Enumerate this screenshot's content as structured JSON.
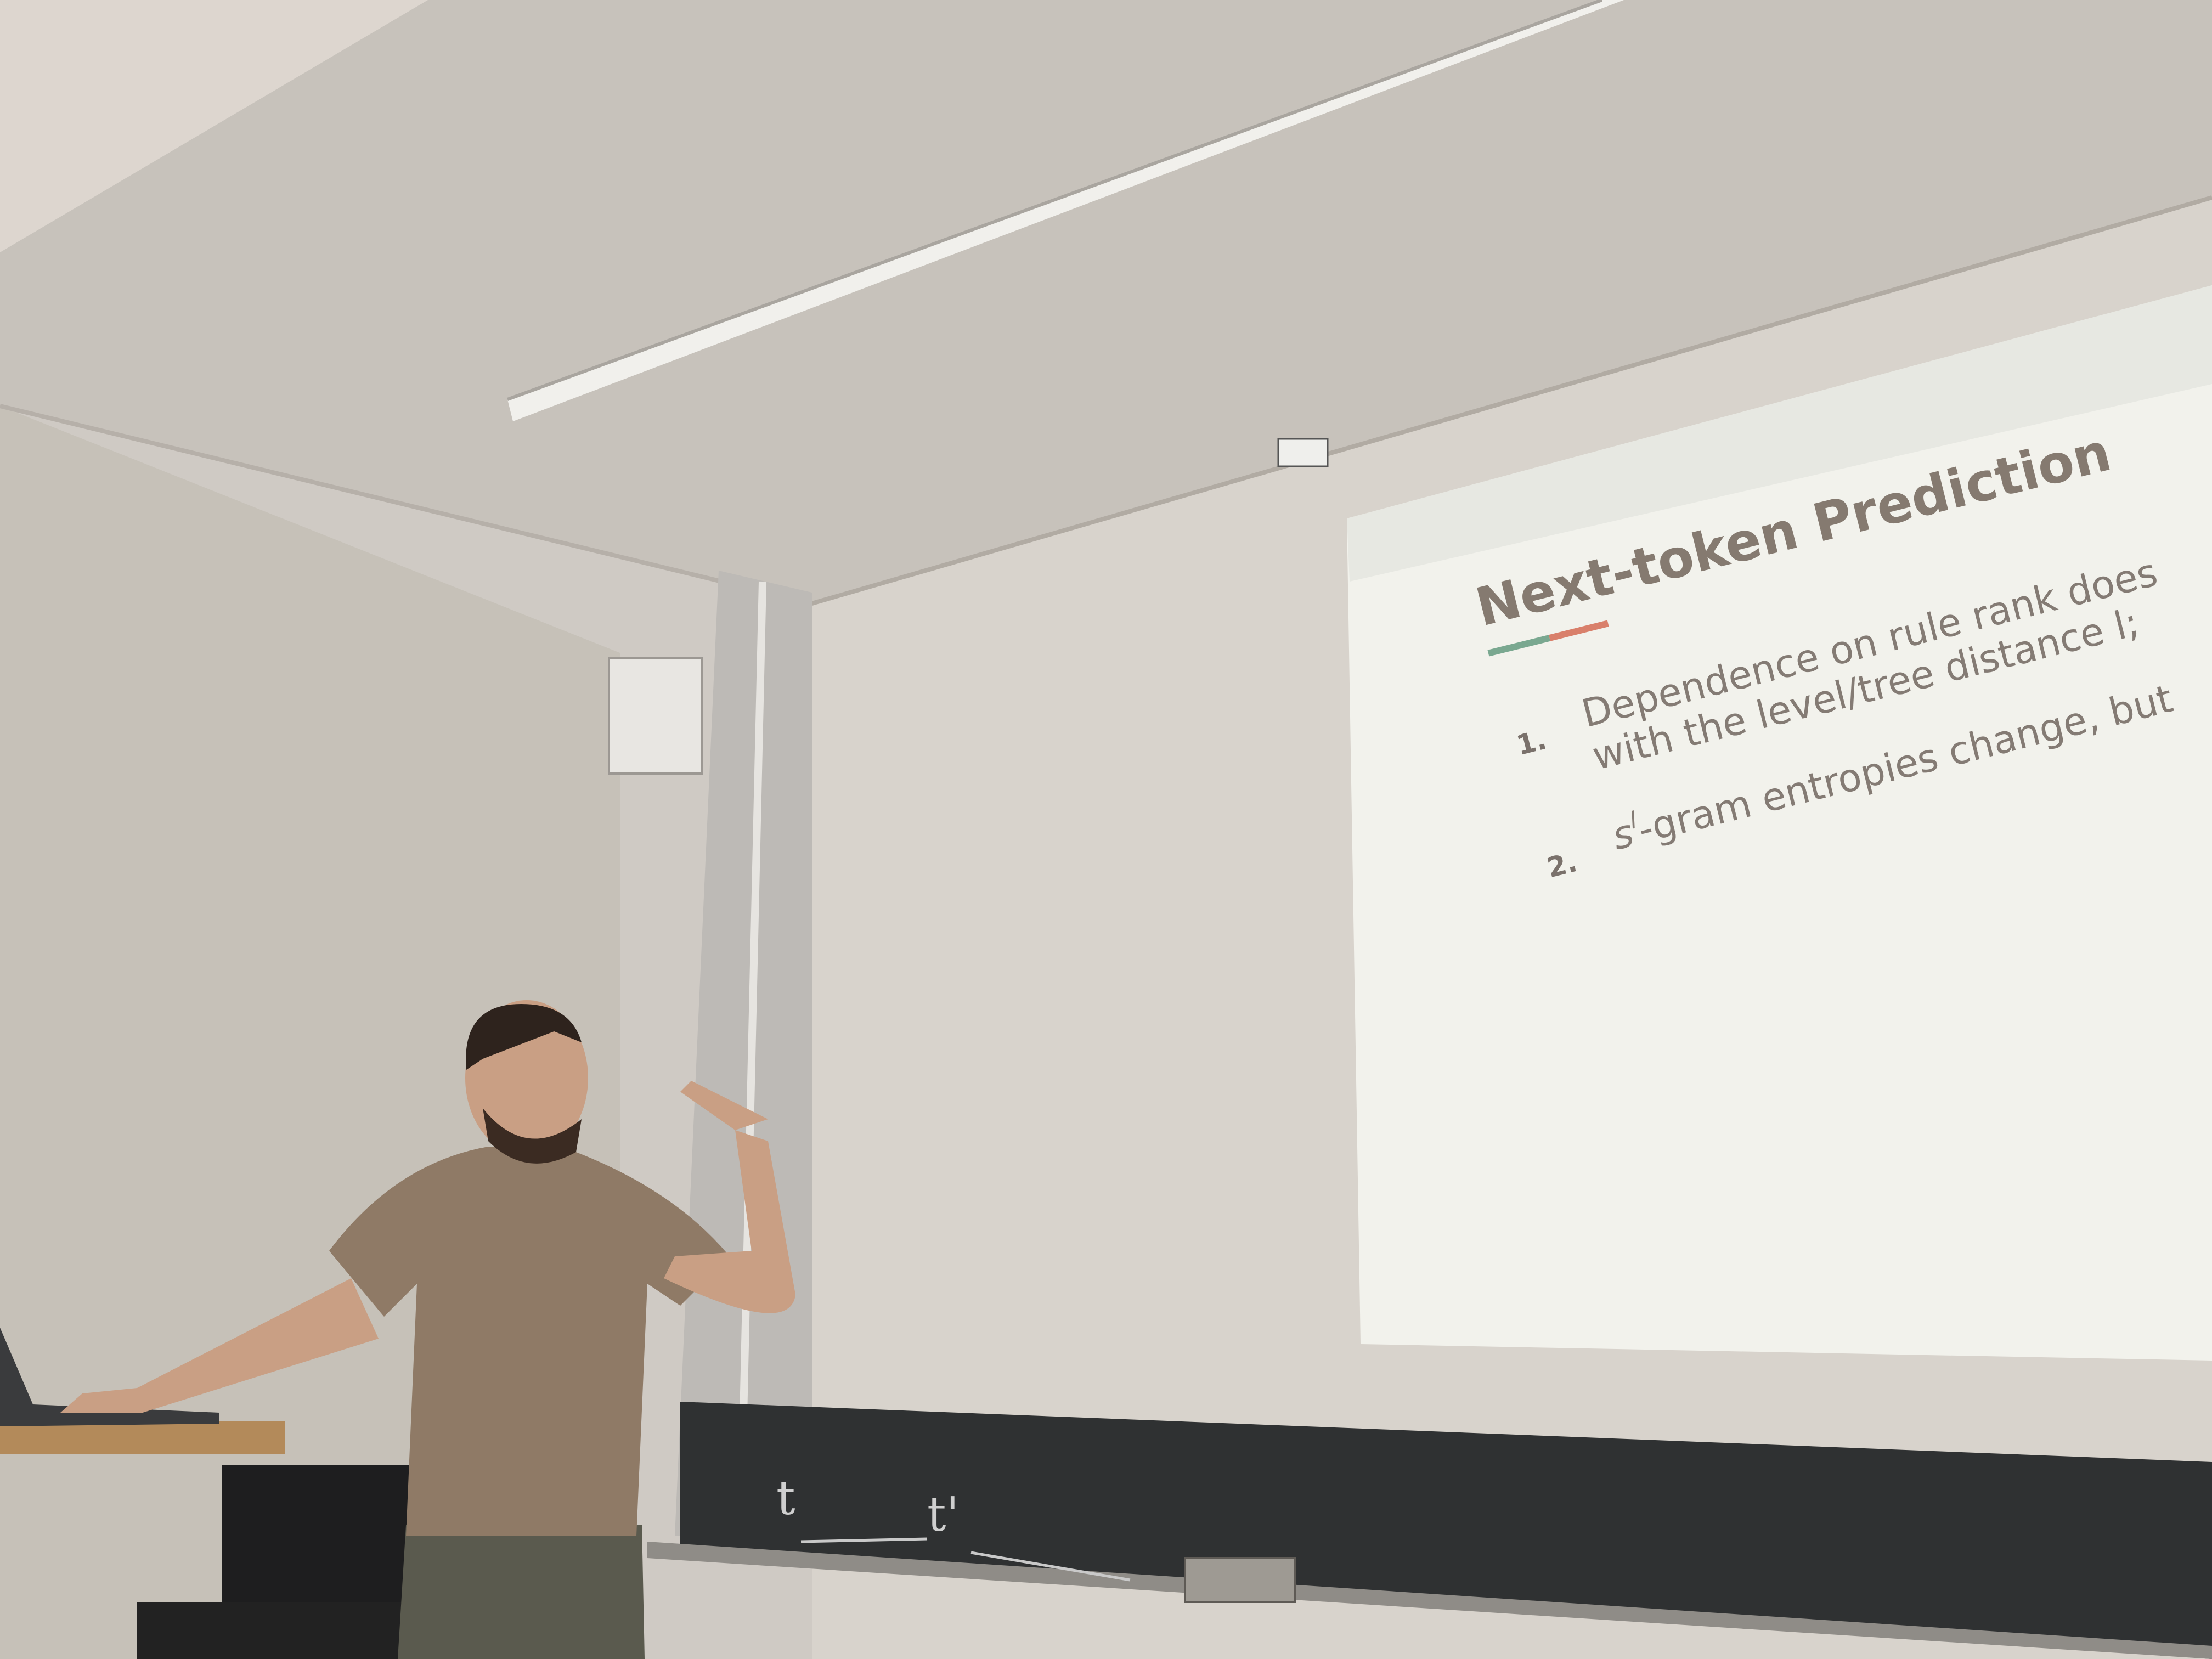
{
  "slide": {
    "title": "Next-token Prediction",
    "accent_colors": [
      "#7aa890",
      "#d9806b"
    ],
    "bullets": [
      {
        "number": "1.",
        "line1": "Dependence on rule rank does",
        "line2": "with the level/tree distance l;"
      },
      {
        "number": "2.",
        "line1": "s",
        "superscript": "l",
        "line1_rest": "-gram entropies change, but"
      }
    ]
  },
  "blackboard": {
    "chalk_marks": [
      "t",
      "t'"
    ]
  },
  "colors": {
    "wall": "#d6d1cb",
    "ceiling": "#c6c1ba",
    "screen": "#f3f3ed",
    "blackboard": "#2f3132",
    "shirt": "#8f7a66"
  }
}
